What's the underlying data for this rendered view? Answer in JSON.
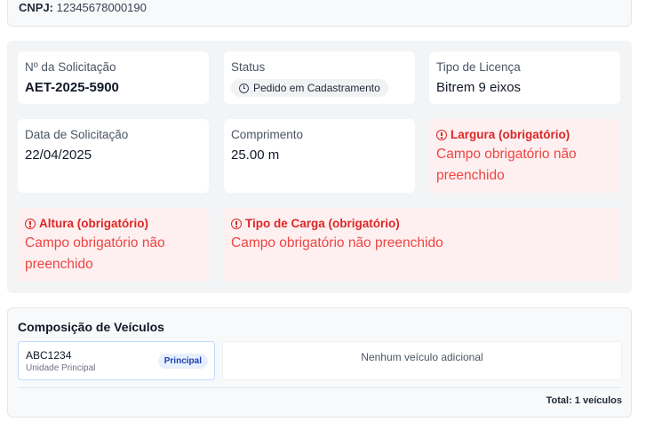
{
  "company": {
    "cnpj_label": "CNPJ:",
    "cnpj_value": "12345678000190"
  },
  "request": {
    "number": {
      "label": "Nº da Solicitação",
      "value": "AET-2025-5900"
    },
    "status": {
      "label": "Status",
      "value": "Pedido em Cadastramento",
      "icon": "clock-icon"
    },
    "license_type": {
      "label": "Tipo de Licença",
      "value": "Bitrem 9 eixos"
    },
    "request_date": {
      "label": "Data de Solicitação",
      "value": "22/04/2025"
    },
    "length": {
      "label": "Comprimento",
      "value": "25.00 m"
    },
    "width": {
      "label": "Largura (obrigatório)",
      "value": "Campo obrigatório não preenchido",
      "icon": "alert-circle-icon"
    },
    "height": {
      "label": "Altura (obrigatório)",
      "value": "Campo obrigatório não preenchido",
      "icon": "alert-circle-icon"
    },
    "cargo_type": {
      "label": "Tipo de Carga (obrigatório)",
      "value": "Campo obrigatório não preenchido",
      "icon": "alert-circle-icon"
    }
  },
  "vehicles": {
    "title": "Composição de Veículos",
    "main": {
      "plate": "ABC1234",
      "unit": "Unidade Principal",
      "badge": "Principal"
    },
    "additional_empty": "Nenhum veículo adicional",
    "total": "Total: 1 veículos"
  },
  "colors": {
    "error": "#dc2626",
    "error_bg": "#fef0f0",
    "badge_bg": "#e8f0fd",
    "badge_text": "#1e40af",
    "panel_bg": "#f3f4f6"
  }
}
